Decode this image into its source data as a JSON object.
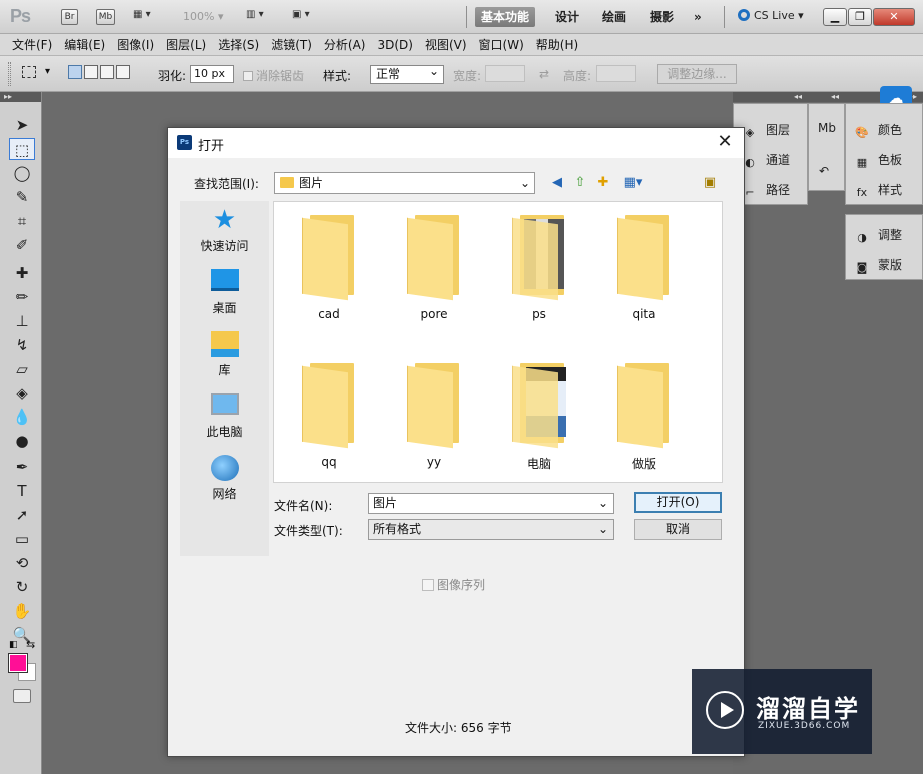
{
  "app": {
    "logo": "Ps",
    "bridge_btn": "Br",
    "minibridge_btn": "Mb",
    "zoom": "100%",
    "workspaces": [
      "基本功能",
      "设计",
      "绘画",
      "摄影"
    ],
    "more": "»",
    "cslive": "CS Live"
  },
  "menu": [
    "文件(F)",
    "编辑(E)",
    "图像(I)",
    "图层(L)",
    "选择(S)",
    "滤镜(T)",
    "分析(A)",
    "3D(D)",
    "视图(V)",
    "窗口(W)",
    "帮助(H)"
  ],
  "options": {
    "feather_label": "羽化:",
    "feather_value": "10 px",
    "antialias_label": "消除锯齿",
    "style_label": "样式:",
    "style_value": "正常",
    "width_label": "宽度:",
    "height_label": "高度:",
    "refine_edge": "调整边缘..."
  },
  "panels": {
    "col1": [
      "图层",
      "通道",
      "路径"
    ],
    "col3a": [
      "颜色",
      "色板",
      "样式"
    ],
    "col3b": [
      "调整",
      "蒙版"
    ]
  },
  "colors": {
    "foreground": "#ff0f96",
    "background": "#ffffff"
  },
  "dialog": {
    "title": "打开",
    "lookin_label": "查找范围(I):",
    "lookin_value": "图片",
    "places": [
      "快速访问",
      "桌面",
      "库",
      "此电脑",
      "网络"
    ],
    "files": [
      {
        "name": "cad",
        "type": "folder"
      },
      {
        "name": "pore",
        "type": "folder"
      },
      {
        "name": "ps",
        "type": "folder-preview"
      },
      {
        "name": "qita",
        "type": "folder"
      },
      {
        "name": "qq",
        "type": "folder"
      },
      {
        "name": "yy",
        "type": "folder"
      },
      {
        "name": "电脑",
        "type": "folder-preview"
      },
      {
        "name": "做版",
        "type": "folder"
      }
    ],
    "filename_label": "文件名(N):",
    "filename_value": "图片",
    "filetype_label": "文件类型(T):",
    "filetype_value": "所有格式",
    "open_button": "打开(O)",
    "cancel_button": "取消",
    "image_sequence": "图像序列",
    "filesize": "文件大小: 656 字节"
  },
  "watermark": {
    "title": "溜溜自学",
    "subtitle": "ZIXUE.3D66.COM"
  }
}
